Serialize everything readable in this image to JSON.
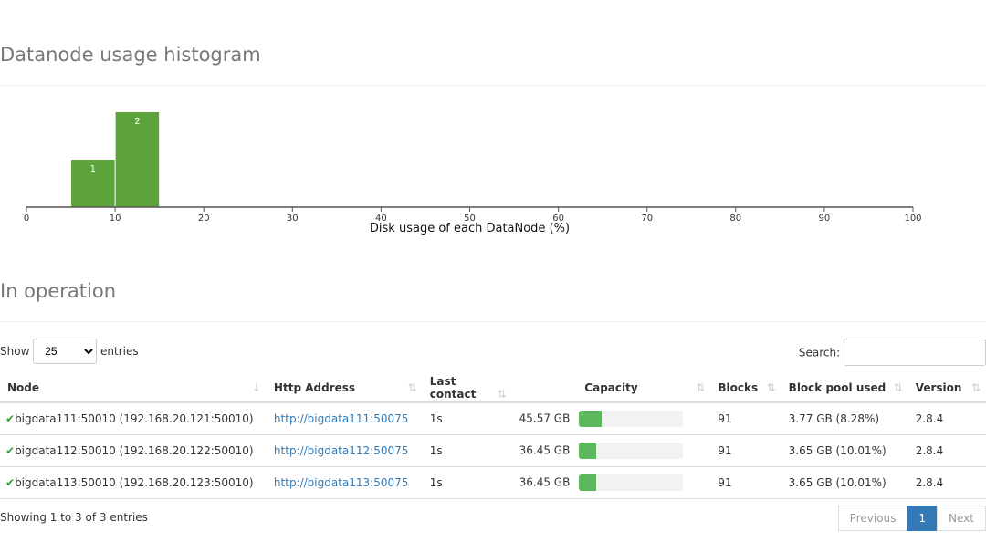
{
  "histogram": {
    "title": "Datanode usage histogram",
    "chart_data": {
      "type": "bar",
      "xlabel": "Disk usage of each DataNode (%)",
      "xlim": [
        0,
        100
      ],
      "xticks": [
        0,
        10,
        20,
        30,
        40,
        50,
        60,
        70,
        80,
        90,
        100
      ],
      "bins": [
        {
          "x0": 5,
          "x1": 10,
          "count": 1
        },
        {
          "x0": 10,
          "x1": 15,
          "count": 2
        }
      ],
      "color": "#5ca33c"
    }
  },
  "operation": {
    "title": "In operation",
    "show_label": "Show",
    "entries_value": "25",
    "entries_label": "entries",
    "search_label": "Search:",
    "columns": [
      "Node",
      "Http Address",
      "Last contact",
      "Capacity",
      "Blocks",
      "Block pool used",
      "Version"
    ],
    "rows": [
      {
        "node": "bigdata111:50010 (192.168.20.121:50010)",
        "http": "http://bigdata111:50075",
        "last": "1s",
        "capacity": "45.57 GB",
        "used_pct": 22,
        "blocks": "91",
        "pool": "3.77 GB (8.28%)",
        "version": "2.8.4"
      },
      {
        "node": "bigdata112:50010 (192.168.20.122:50010)",
        "http": "http://bigdata112:50075",
        "last": "1s",
        "capacity": "36.45 GB",
        "used_pct": 16,
        "blocks": "91",
        "pool": "3.65 GB (10.01%)",
        "version": "2.8.4"
      },
      {
        "node": "bigdata113:50010 (192.168.20.123:50010)",
        "http": "http://bigdata113:50075",
        "last": "1s",
        "capacity": "36.45 GB",
        "used_pct": 16,
        "blocks": "91",
        "pool": "3.65 GB (10.01%)",
        "version": "2.8.4"
      }
    ],
    "footer": "Showing 1 to 3 of 3 entries",
    "pagination": {
      "prev": "Previous",
      "page": "1",
      "next": "Next"
    }
  }
}
